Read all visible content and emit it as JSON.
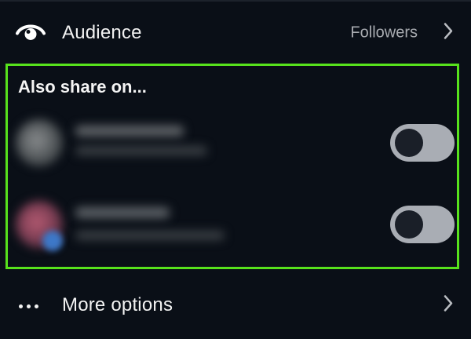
{
  "audience": {
    "label": "Audience",
    "value": "Followers"
  },
  "share": {
    "title": "Also share on..."
  },
  "more": {
    "label": "More options"
  },
  "colors": {
    "background": "#0a0f17",
    "highlight_border": "#57e21c",
    "toggle_track": "#a9adb4",
    "toggle_knob": "#1a1f28"
  },
  "icons": {
    "audience": "eye-icon",
    "chevron": "chevron-right-icon",
    "more": "more-dots-icon"
  },
  "accounts": [
    {
      "toggle_on": false
    },
    {
      "toggle_on": false
    }
  ]
}
